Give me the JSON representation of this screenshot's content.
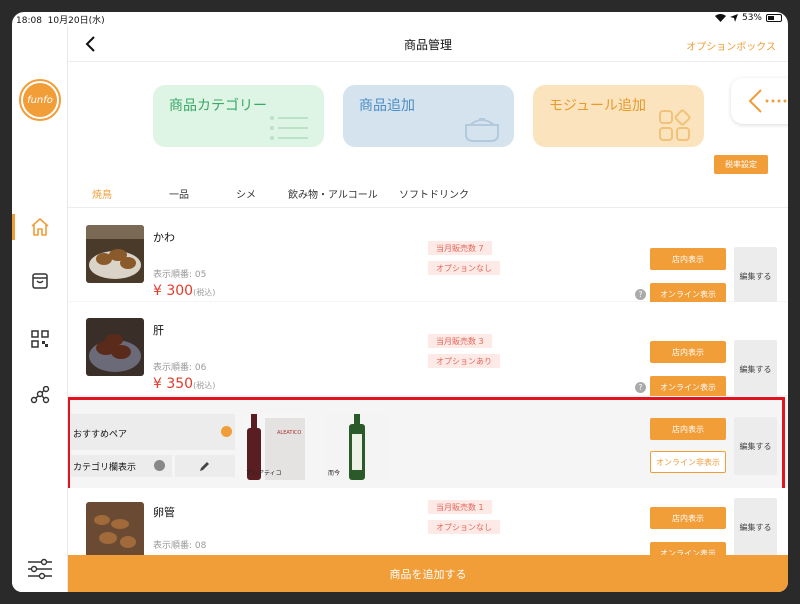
{
  "status": {
    "time": "18:08",
    "date": "10月20日(水)",
    "battery": "53%",
    "battery_fraction": 0.53
  },
  "brand": {
    "logo_text": "funfo"
  },
  "header": {
    "title": "商品管理",
    "option": "オプションボックス"
  },
  "cards": {
    "category": "商品カテゴリー",
    "add_product": "商品追加",
    "add_module": "モジュール追加"
  },
  "tax_button": "税率設定",
  "tabs": [
    "焼鳥",
    "一品",
    "シメ",
    "飲み物・アルコール",
    "ソフトドリンク"
  ],
  "labels": {
    "store_display": "店内表示",
    "online_display": "オンライン表示",
    "online_hidden": "オンライン非表示",
    "edit": "編集する",
    "tax_included": "(税込)",
    "help": "?"
  },
  "items": [
    {
      "name": "かわ",
      "order": "表示順番: 05",
      "price": "¥ 300",
      "sales": "当月販売数 7",
      "option": "オプションなし"
    },
    {
      "name": "肝",
      "order": "表示順番: 06",
      "price": "¥ 350",
      "sales": "当月販売数 3",
      "option": "オプションあり"
    },
    {
      "name": "卵管",
      "order": "表示順番: 08",
      "price": "",
      "sales": "当月販売数 1",
      "option": "オプションなし"
    }
  ],
  "pairing": {
    "recommend_label": "おすすめペア",
    "category_label": "カテゴリ欄表示",
    "wine_caption": "アレアティコ",
    "sake_caption": "而今"
  },
  "bottom": {
    "add_label": "商品を追加する"
  },
  "colors": {
    "accent": "#f19d38",
    "price": "#e13b2b",
    "highlight": "#e0131e"
  }
}
